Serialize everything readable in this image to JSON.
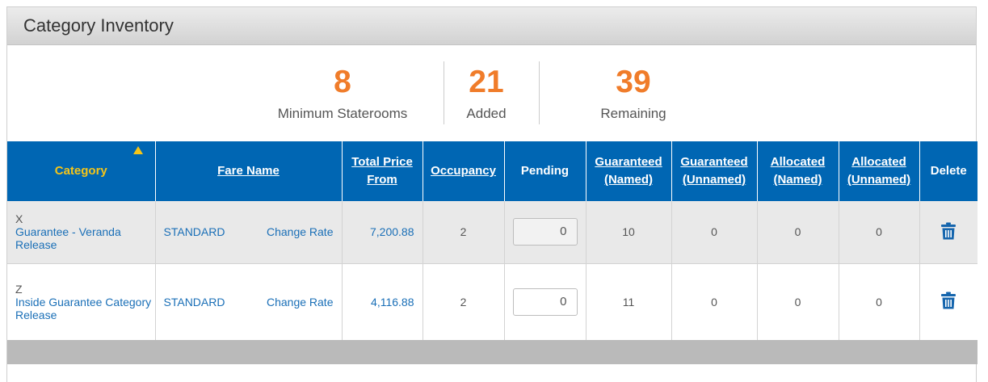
{
  "panel": {
    "title": "Category Inventory"
  },
  "stats": {
    "minimum": {
      "value": "8",
      "label": "Minimum Staterooms"
    },
    "added": {
      "value": "21",
      "label": "Added"
    },
    "remaining": {
      "value": "39",
      "label": "Remaining"
    }
  },
  "colors": {
    "header_blue": "#0066b3",
    "accent_orange": "#f07c2a",
    "sort_yellow": "#f5c518",
    "link_blue": "#1a6fb7"
  },
  "table": {
    "headers": {
      "category": "Category",
      "fare_name": "Fare Name",
      "total_price_1": "Total Price",
      "total_price_2": "From",
      "occupancy": "Occupancy",
      "pending": "Pending",
      "guar_named_1": "Guaranteed",
      "guar_named_2": "(Named)",
      "guar_unnamed_1": "Guaranteed",
      "guar_unnamed_2": "(Unnamed)",
      "alloc_named_1": "Allocated",
      "alloc_named_2": "(Named)",
      "alloc_unnamed_1": "Allocated",
      "alloc_unnamed_2": "(Unnamed)",
      "delete": "Delete"
    },
    "sort_icon": "sort-ascending-icon",
    "delete_icon": "trash-icon",
    "rows": [
      {
        "code": "X",
        "name": "Guarantee - Veranda Release",
        "fare": "STANDARD",
        "change_rate": "Change Rate",
        "price": "7,200.88",
        "occupancy": "2",
        "pending": "0",
        "guar_named": "10",
        "guar_unnamed": "0",
        "alloc_named": "0",
        "alloc_unnamed": "0"
      },
      {
        "code": "Z",
        "name": "Inside Guarantee Category Release",
        "fare": "STANDARD",
        "change_rate": "Change Rate",
        "price": "4,116.88",
        "occupancy": "2",
        "pending": "0",
        "guar_named": "11",
        "guar_unnamed": "0",
        "alloc_named": "0",
        "alloc_unnamed": "0"
      }
    ]
  }
}
